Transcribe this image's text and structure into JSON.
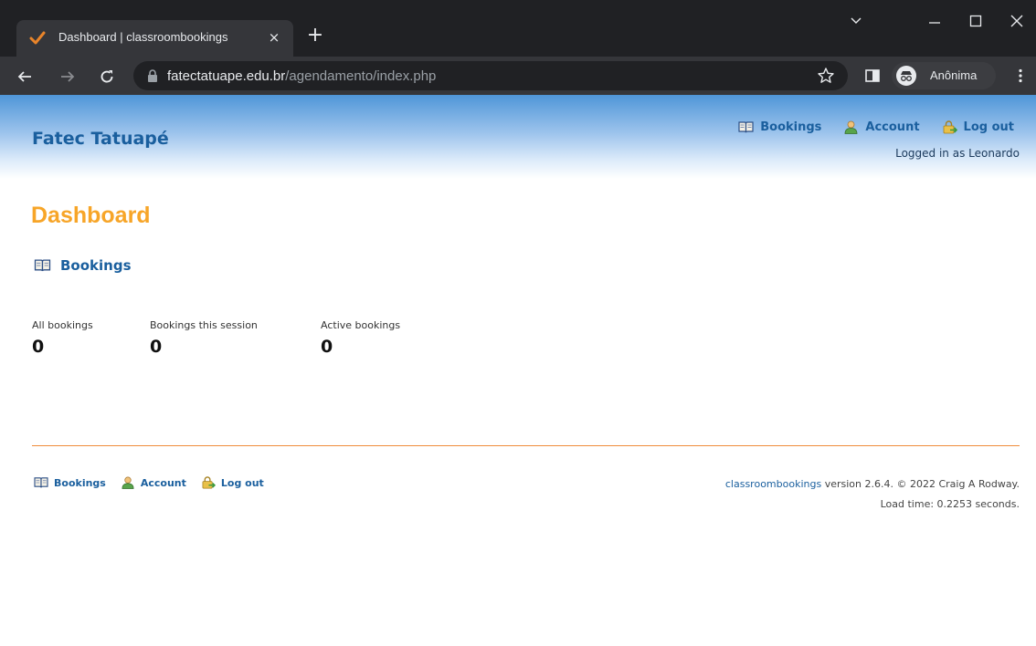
{
  "browser": {
    "tab_title": "Dashboard | classroombookings",
    "tab_close": "×",
    "new_tab": "+",
    "url_host": "fatectatuape.edu.br",
    "url_path": "/agendamento/index.php",
    "profile_label": "Anônima"
  },
  "header": {
    "site_name": "Fatec Tatuapé",
    "nav": [
      {
        "label": "Bookings",
        "icon": "book-icon"
      },
      {
        "label": "Account",
        "icon": "user-icon"
      },
      {
        "label": "Log out",
        "icon": "logout-icon"
      }
    ],
    "logged_in": "Logged in as Leonardo"
  },
  "main": {
    "title": "Dashboard",
    "section_link": "Bookings",
    "stats": [
      {
        "label": "All bookings",
        "value": "0"
      },
      {
        "label": "Bookings this session",
        "value": "0"
      },
      {
        "label": "Active bookings",
        "value": "0"
      }
    ]
  },
  "footer": {
    "nav": [
      {
        "label": "Bookings"
      },
      {
        "label": "Account"
      },
      {
        "label": "Log out"
      }
    ],
    "app_name": "classroombookings",
    "version_text": " version 2.6.4. © 2022 Craig A Rodway.",
    "load_time": "Load time: 0.2253 seconds."
  },
  "colors": {
    "link": "#1a5f9e",
    "title": "#f7a528",
    "rule": "#f08c3c"
  }
}
